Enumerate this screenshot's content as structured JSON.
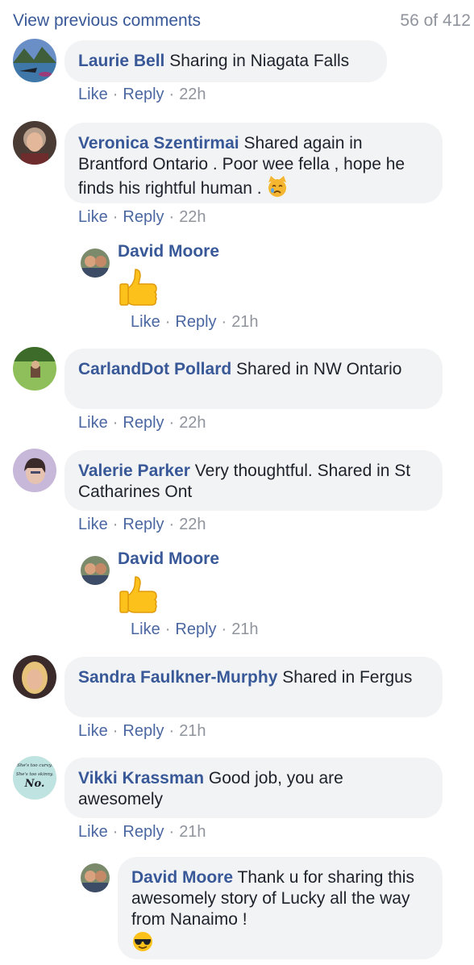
{
  "header": {
    "view_previous": "View previous comments",
    "count": "56 of 412"
  },
  "actions": {
    "like": "Like",
    "reply": "Reply"
  },
  "comments": [
    {
      "name": "Laurie Bell",
      "text": "Sharing in Niagata Falls",
      "time": "22h"
    },
    {
      "name": "Veronica Szentirmai",
      "text": "Shared again in Brantford Ontario . Poor wee fella , hope he finds his rightful human . ",
      "emoji": "crying-cat-emoji",
      "time": "22h"
    },
    {
      "name": "CarlandDot Pollard",
      "text": "Shared in NW Ontario",
      "time": "22h"
    },
    {
      "name": "Valerie Parker",
      "text": "Very thoughtful. Shared in St Catharines Ont",
      "time": "22h"
    },
    {
      "name": "Sandra Faulkner-Murphy",
      "text": "Shared in Fergus",
      "time": "21h"
    },
    {
      "name": "Vikki Krassman",
      "text": "Good job, you are awesomely",
      "time": "21h"
    }
  ],
  "replies": [
    {
      "name": "David Moore",
      "emoji": "thumbs-up-emoji",
      "time": "21h"
    },
    {
      "name": "David Moore",
      "emoji": "thumbs-up-emoji",
      "time": "21h"
    },
    {
      "name": "David Moore",
      "text": "Thank u for sharing this awesomely story of Lucky all the way from Nanaimo !",
      "emoji": "sunglasses-emoji"
    }
  ],
  "avatar_image_text": [
    "She's too curvy.",
    "She's too skinny.",
    "No."
  ],
  "colors": {
    "name": "#385898",
    "action": "#4b67a1",
    "meta": "#90949c",
    "bubble": "#f2f3f5",
    "text": "#1d2129"
  }
}
